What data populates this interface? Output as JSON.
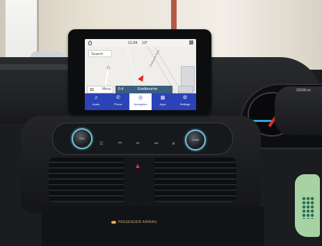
{
  "status": {
    "time": "11:34",
    "temperature": "13°"
  },
  "map": {
    "search_label": "Search",
    "menu_label": "Menu",
    "road_label": "Chatsworth Road"
  },
  "destination": {
    "distance": "0.4",
    "name": "Eastbourne"
  },
  "nav_items": [
    {
      "label": "Audio",
      "icon": "music-note-icon",
      "active": false
    },
    {
      "label": "Phone",
      "icon": "phone-icon",
      "active": false
    },
    {
      "label": "Navigation",
      "icon": "compass-icon",
      "active": true
    },
    {
      "label": "Apps",
      "icon": "apps-icon",
      "active": false
    },
    {
      "label": "Settings",
      "icon": "settings-icon",
      "active": false
    }
  ],
  "console": {
    "vol_label": "VOL",
    "tune_label": "TUNE",
    "airbag_text": "PASSENGER AIRBAG"
  },
  "cluster": {
    "mileage": "22028 mi"
  },
  "colors": {
    "nav_bar": "#2b43b8",
    "destination_bar": "#3c5e7e",
    "position_arrow": "#e3231f",
    "knob_ring": "#6ec3d9"
  }
}
